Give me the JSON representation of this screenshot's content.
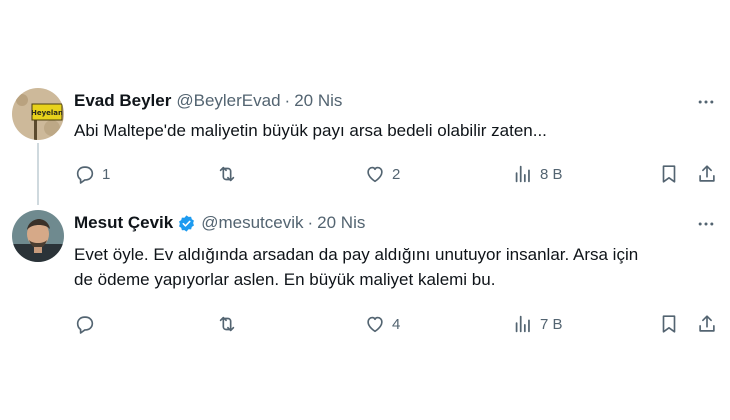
{
  "tweets": [
    {
      "name": "Evad Beyler",
      "handle": "@BeylerEvad",
      "separator": "·",
      "date": "20 Nis",
      "text": "Abi Maltepe'de maliyetin büyük payı arsa bedeli olabilir zaten...",
      "avatar_sign_text": "Heyelan",
      "verified": false,
      "replies": "1",
      "retweets": "",
      "likes": "2",
      "views": "8 B"
    },
    {
      "name": "Mesut Çevik",
      "handle": "@mesutcevik",
      "separator": "·",
      "date": "20 Nis",
      "text_line1": "Evet öyle. Ev aldığında arsadan da pay aldığını unutuyor insanlar. Arsa için",
      "text_line2": "de ödeme yapıyorlar aslen. En büyük maliyet kalemi bu.",
      "verified": true,
      "replies": "",
      "retweets": "",
      "likes": "4",
      "views": "7 B"
    }
  ],
  "colors": {
    "text": "#0f1419",
    "secondary": "#536471",
    "verified_blue": "#1d9bf0",
    "thread_line": "#cfd9de"
  },
  "icons": [
    "reply-icon",
    "retweet-icon",
    "like-icon",
    "views-icon",
    "bookmark-icon",
    "share-icon",
    "more-icon",
    "verified-badge-icon"
  ]
}
